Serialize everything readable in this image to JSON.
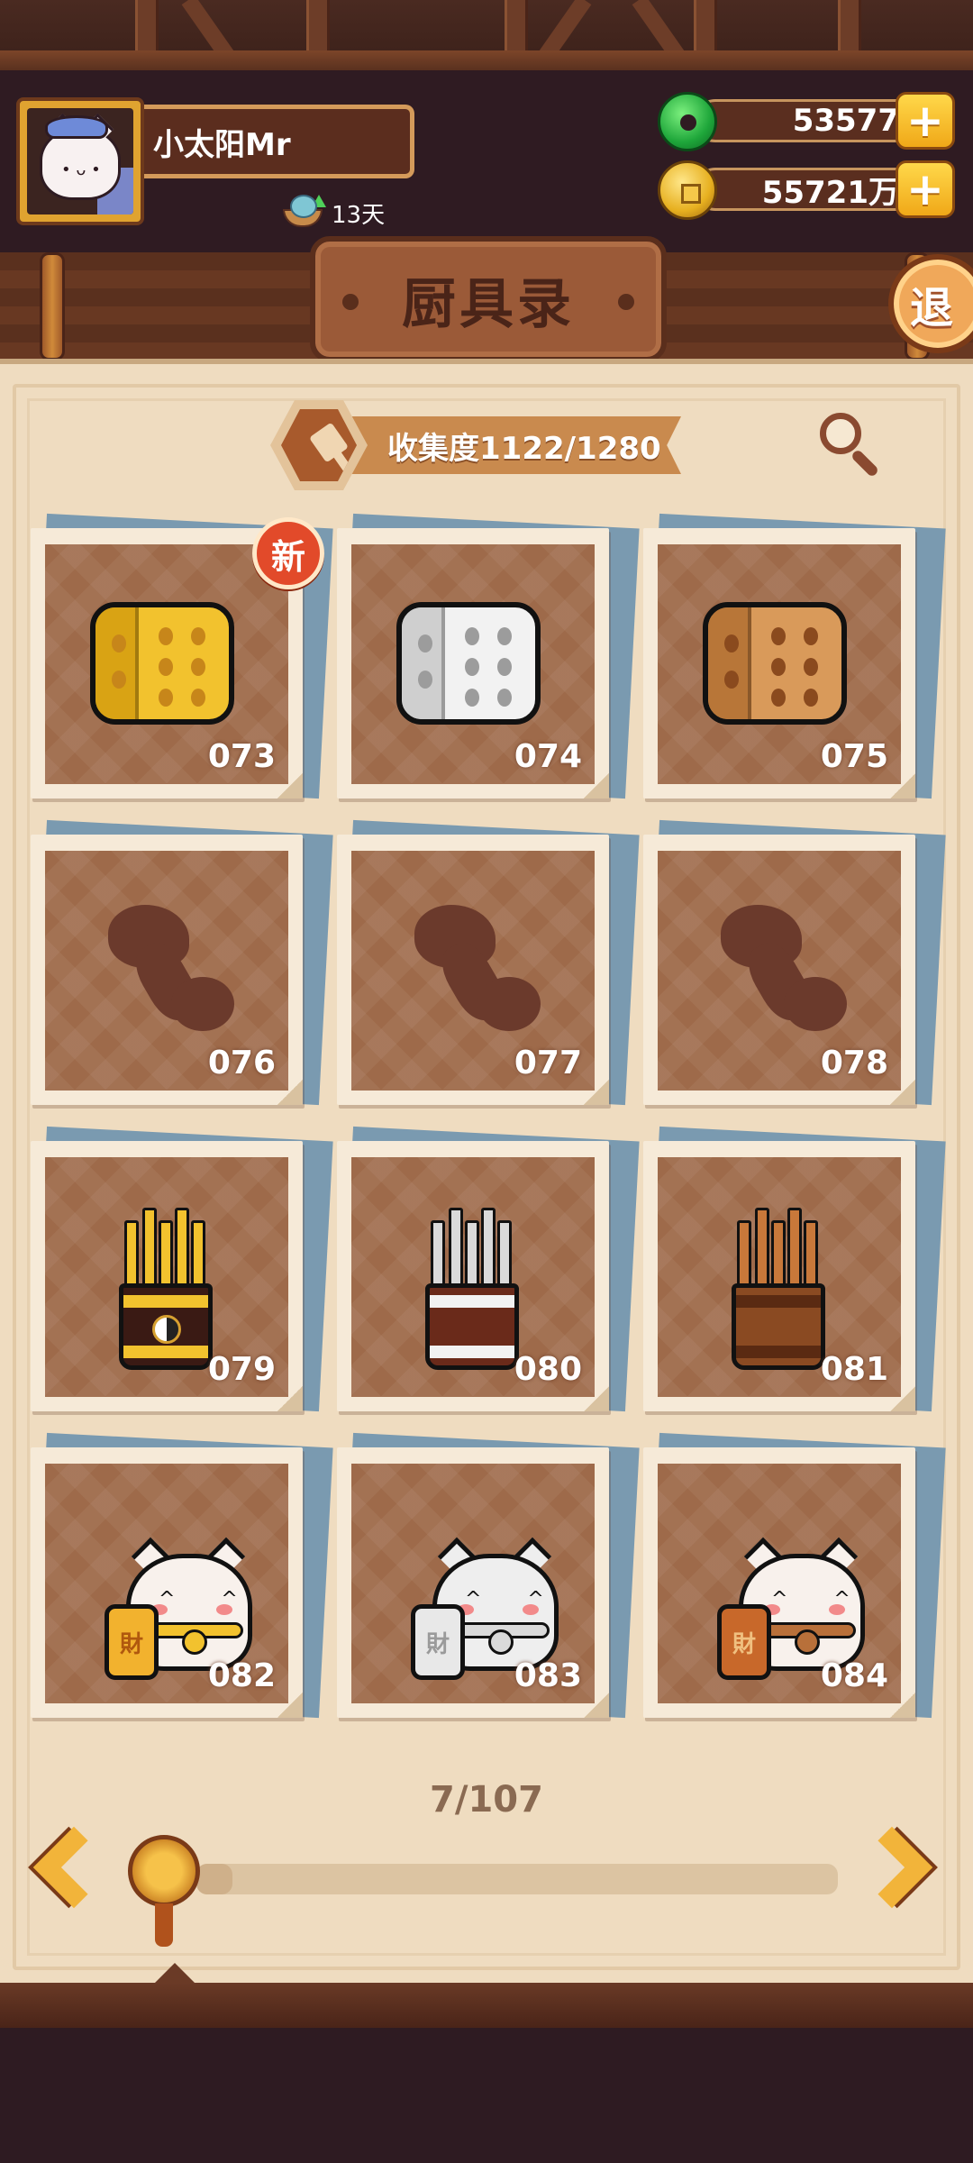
{
  "player": {
    "name": "小太阳Mr",
    "days": "13天"
  },
  "currencies": {
    "jade": "53577",
    "gold": "55721万",
    "plus_label": "+"
  },
  "title": "厨具录",
  "exit_label": "退",
  "collection": {
    "label": "收集度1122/1280",
    "collected": 1122,
    "total": 1280
  },
  "new_badge": "新",
  "items": [
    {
      "num": "073",
      "kind": "dice",
      "tier": "gold",
      "is_new": true
    },
    {
      "num": "074",
      "kind": "dice",
      "tier": "silver",
      "is_new": false
    },
    {
      "num": "075",
      "kind": "dice",
      "tier": "bronze",
      "is_new": false
    },
    {
      "num": "076",
      "kind": "locked",
      "tier": "",
      "is_new": false
    },
    {
      "num": "077",
      "kind": "locked",
      "tier": "",
      "is_new": false
    },
    {
      "num": "078",
      "kind": "locked",
      "tier": "",
      "is_new": false
    },
    {
      "num": "079",
      "kind": "sticks",
      "tier": "gold",
      "is_new": false
    },
    {
      "num": "080",
      "kind": "sticks",
      "tier": "silver",
      "is_new": false
    },
    {
      "num": "081",
      "kind": "sticks",
      "tier": "bronze",
      "is_new": false
    },
    {
      "num": "082",
      "kind": "cat",
      "tier": "gold",
      "is_new": false,
      "tag": "財"
    },
    {
      "num": "083",
      "kind": "cat",
      "tier": "silver",
      "is_new": false,
      "tag": "財"
    },
    {
      "num": "084",
      "kind": "cat",
      "tier": "bronze",
      "is_new": false,
      "tag": "財"
    }
  ],
  "pagination": {
    "label": "7/107",
    "current": 7,
    "total": 107
  },
  "icons": {
    "avatar": "cat-avatar",
    "days": "boat-icon",
    "jade": "jade-coin-icon",
    "gold": "gold-coin-icon",
    "collection": "spatula-icon",
    "search": "magnifier-icon",
    "prev": "chevron-left-icon",
    "next": "chevron-right-icon"
  }
}
